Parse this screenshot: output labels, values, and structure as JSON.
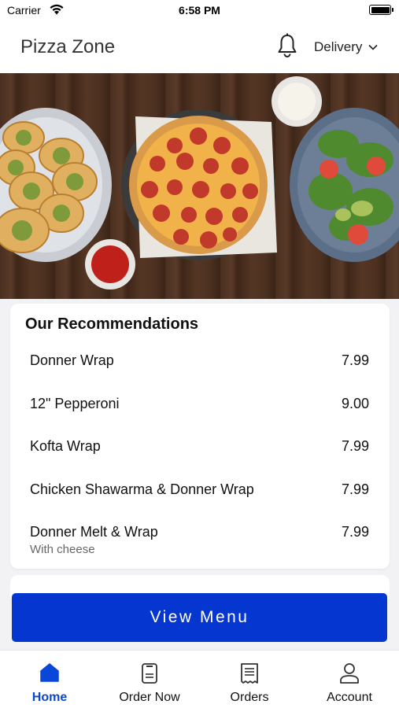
{
  "status_bar": {
    "carrier": "Carrier",
    "time": "6:58 PM"
  },
  "header": {
    "title": "Pizza Zone",
    "delivery_label": "Delivery",
    "bell_icon": "bell-icon",
    "dropdown_icon": "chevron-down-icon"
  },
  "recommendations": {
    "title": "Our Recommendations",
    "items": [
      {
        "name": "Donner Wrap",
        "price": "7.99",
        "note": ""
      },
      {
        "name": "12\" Pepperoni",
        "price": "9.00",
        "note": ""
      },
      {
        "name": "Kofta Wrap",
        "price": "7.99",
        "note": ""
      },
      {
        "name": "Chicken Shawarma & Donner Wrap",
        "price": "7.99",
        "note": ""
      },
      {
        "name": "Donner Melt & Wrap",
        "price": "7.99",
        "note": "With cheese"
      }
    ]
  },
  "view_menu_label": "View Menu",
  "tabs": [
    {
      "label": "Home",
      "icon": "home-icon",
      "active": true
    },
    {
      "label": "Order Now",
      "icon": "order-icon",
      "active": false
    },
    {
      "label": "Orders",
      "icon": "receipt-icon",
      "active": false
    },
    {
      "label": "Account",
      "icon": "person-icon",
      "active": false
    }
  ],
  "colors": {
    "accent": "#0537d0",
    "active_tab": "#0a46d8"
  }
}
